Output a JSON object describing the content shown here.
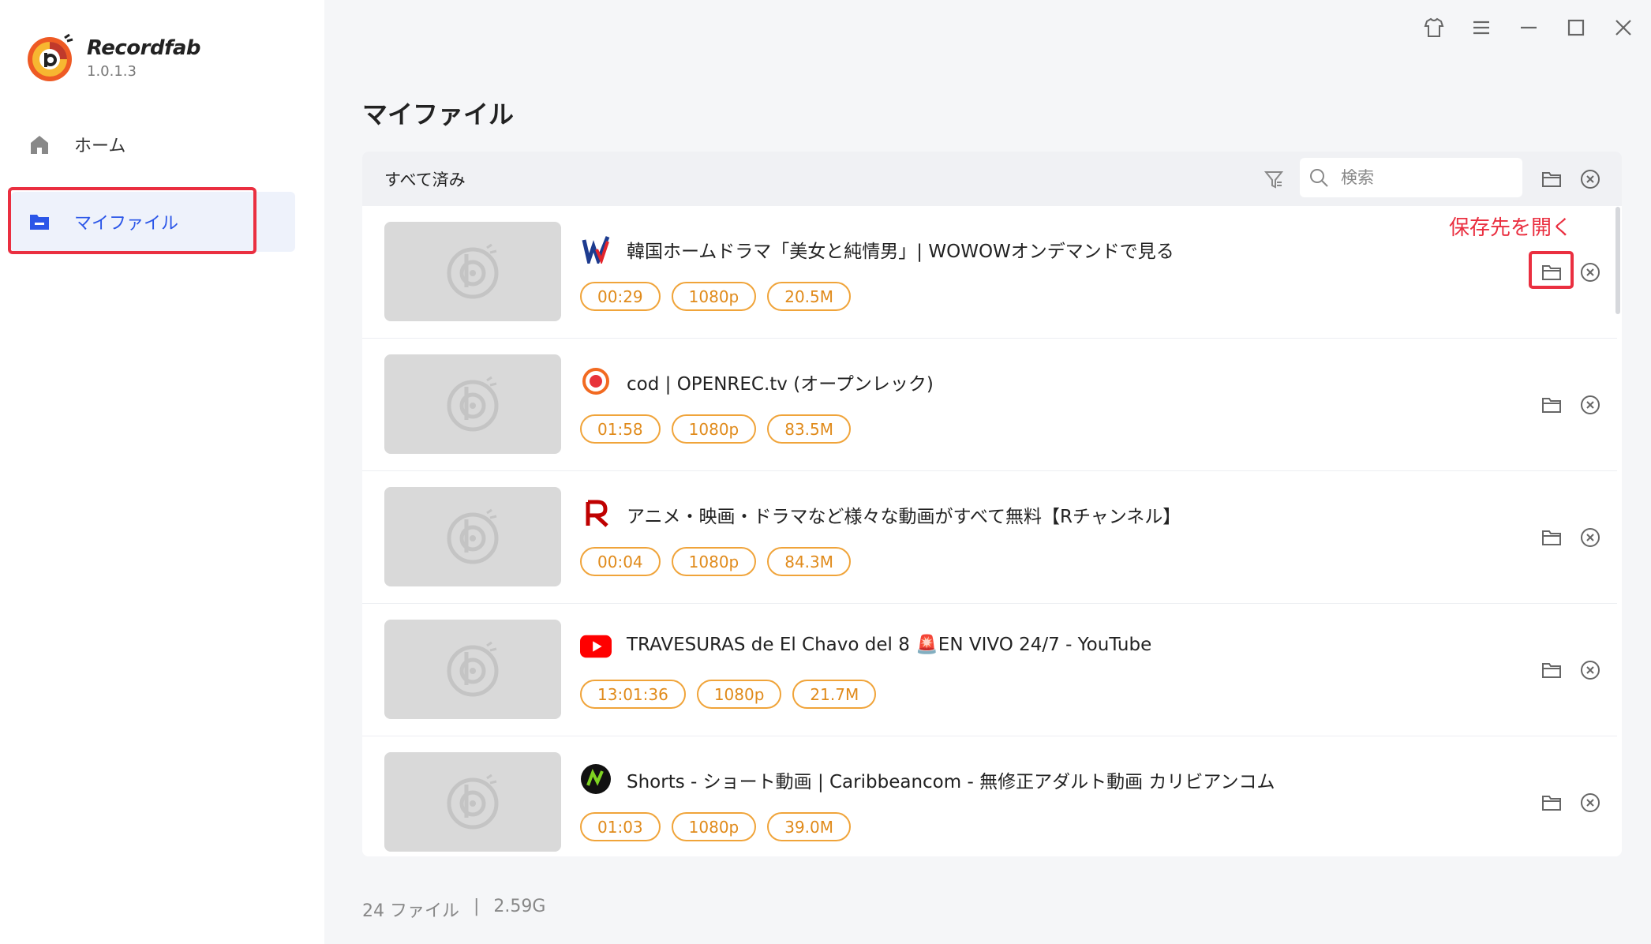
{
  "app": {
    "name": "Recordfab",
    "version": "1.0.1.3"
  },
  "sidebar": {
    "items": [
      {
        "label": "ホーム",
        "icon": "home-icon"
      },
      {
        "label": "マイファイル",
        "icon": "folder-icon",
        "active": true
      }
    ]
  },
  "window_controls": [
    "tshirt-icon",
    "menu-icon",
    "minimize-icon",
    "maximize-icon",
    "close-icon"
  ],
  "main": {
    "title": "マイファイル",
    "filter_label": "すべて済み",
    "search": {
      "placeholder": "検索",
      "value": ""
    },
    "annotation": "保存先を開く",
    "rows": [
      {
        "title": "韓国ホームドラマ「美女と純情男」| WOWOWオンデマンドで見る",
        "site_icon": "wowow-icon",
        "duration": "00:29",
        "resolution": "1080p",
        "size": "20.5M"
      },
      {
        "title": "cod | OPENREC.tv (オープンレック)",
        "site_icon": "openrec-icon",
        "duration": "01:58",
        "resolution": "1080p",
        "size": "83.5M"
      },
      {
        "title": "アニメ・映画・ドラマなど様々な動画がすべて無料【Rチャンネル】",
        "site_icon": "rakuten-icon",
        "duration": "00:04",
        "resolution": "1080p",
        "size": "84.3M"
      },
      {
        "title": "TRAVESURAS de El Chavo del 8 🚨EN VIVO 24/7 - YouTube",
        "site_icon": "youtube-icon",
        "duration": "13:01:36",
        "resolution": "1080p",
        "size": "21.7M"
      },
      {
        "title": "Shorts - ショート動画 | Caribbeancom - 無修正アダルト動画 カリビアンコム",
        "site_icon": "caribbeancom-icon",
        "duration": "01:03",
        "resolution": "1080p",
        "size": "39.0M"
      }
    ]
  },
  "footer": {
    "file_count": "24 ファイル",
    "separator": "|",
    "total_size": "2.59G"
  },
  "colors": {
    "accent": "#2b56e8",
    "tag_orange": "#e08a1a",
    "annotation_red": "#ea2f40"
  }
}
